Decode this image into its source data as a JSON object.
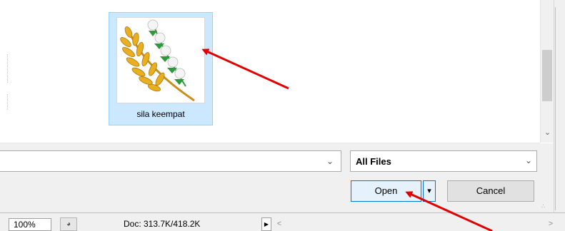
{
  "file_list": {
    "items": [
      {
        "label": "sila keempat",
        "icon": "rice-sheaf-cotton-icon",
        "selected": true
      }
    ]
  },
  "file_name_input": {
    "value": ""
  },
  "file_type": {
    "selected": "All Files"
  },
  "buttons": {
    "open": "Open",
    "open_split": "▾",
    "cancel": "Cancel"
  },
  "status_bar": {
    "zoom": "100%",
    "doc_info": "Doc: 313.7K/418.2K"
  },
  "colors": {
    "selection_bg": "#cce8ff",
    "selection_border": "#99d1ff",
    "primary_border": "#0078d7",
    "annotation_arrow": "#e00000",
    "rice_gold": "#e8b020",
    "cotton_green": "#2e9a3c"
  }
}
